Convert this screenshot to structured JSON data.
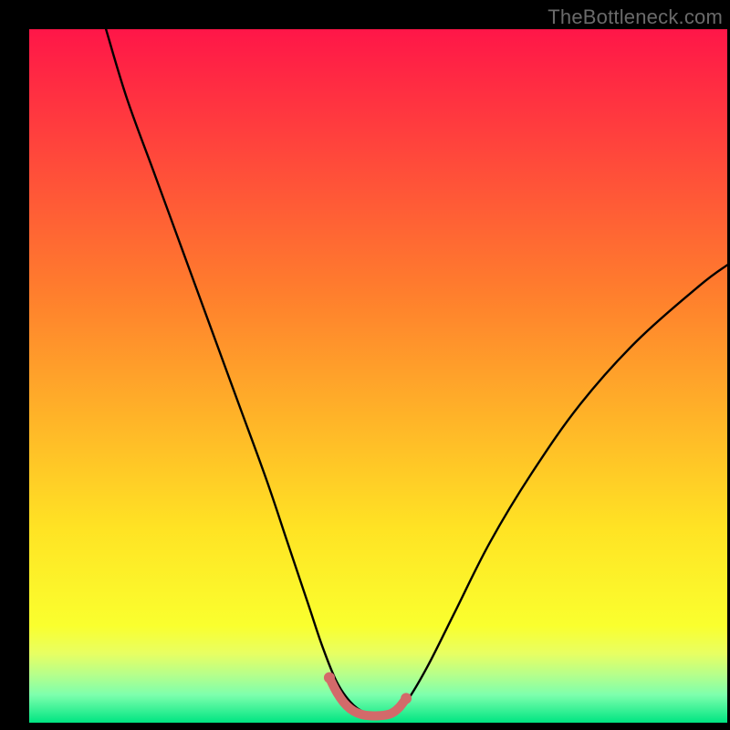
{
  "watermark": "TheBottleneck.com",
  "colors": {
    "gradient_top": "#ff1648",
    "gradient_mid_upper": "#ff7e2d",
    "gradient_mid": "#ffe324",
    "gradient_low1": "#faff2e",
    "gradient_low2": "#e8ff62",
    "gradient_low3": "#b7ff8a",
    "gradient_low4": "#7dffad",
    "gradient_bottom": "#00e582",
    "curve": "#000000",
    "highlight": "#d36a6a"
  },
  "chart_data": {
    "type": "line",
    "title": "",
    "xlabel": "",
    "ylabel": "",
    "xlim": [
      0,
      100
    ],
    "ylim": [
      0,
      100
    ],
    "series": [
      {
        "name": "bottleneck-curve",
        "x": [
          11,
          14,
          18,
          22,
          26,
          30,
          34,
          37,
          40,
          42,
          44,
          46,
          48,
          50,
          52,
          54,
          57,
          61,
          66,
          72,
          79,
          87,
          96,
          100
        ],
        "y": [
          100,
          90,
          79,
          68,
          57,
          46,
          35,
          26,
          17,
          11,
          6,
          3,
          1.5,
          1,
          1.5,
          3,
          8,
          16,
          26,
          36,
          46,
          55,
          63,
          66
        ]
      },
      {
        "name": "optimal-range-highlight",
        "x": [
          43,
          44,
          45,
          46,
          47,
          48,
          49,
          50,
          51,
          52,
          53,
          54
        ],
        "y": [
          6.5,
          4.5,
          3,
          2,
          1.4,
          1.1,
          1,
          1,
          1.1,
          1.4,
          2.2,
          3.5
        ]
      }
    ],
    "annotations": []
  }
}
